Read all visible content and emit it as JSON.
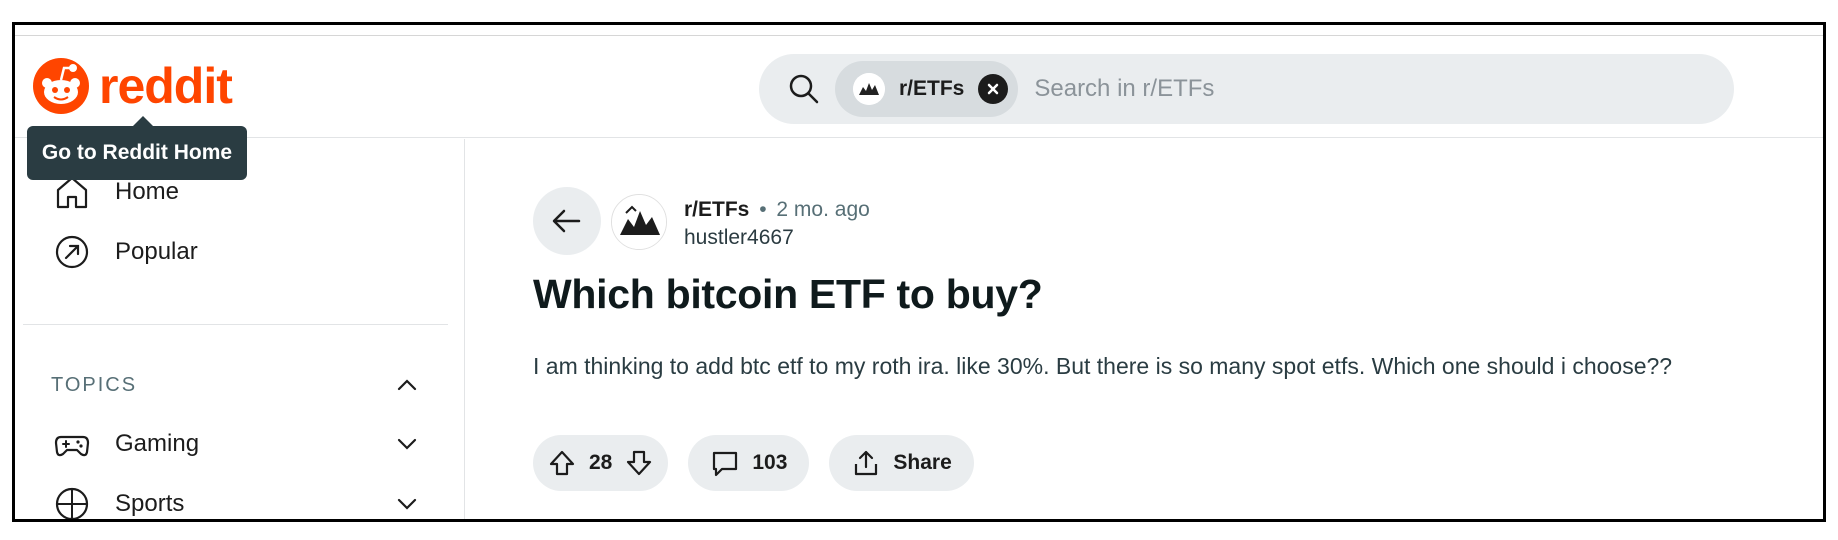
{
  "header": {
    "logo_text": "reddit",
    "brand_color": "#ff4500",
    "tooltip": "Go to Reddit Home",
    "search": {
      "chip_label": "r/ETFs",
      "placeholder": "Search in r/ETFs"
    }
  },
  "sidebar": {
    "items": [
      {
        "label": "Home",
        "icon": "home-icon"
      },
      {
        "label": "Popular",
        "icon": "popular-icon"
      }
    ],
    "topics_label": "TOPICS",
    "topics": [
      {
        "label": "Gaming",
        "icon": "gamepad-icon"
      },
      {
        "label": "Sports",
        "icon": "sports-icon"
      }
    ]
  },
  "post": {
    "subreddit": "r/ETFs",
    "separator": "•",
    "time": "2 mo. ago",
    "author": "hustler4667",
    "title": "Which bitcoin ETF to buy?",
    "body": "I am thinking to add btc etf to my roth ira. like 30%. But there is so many spot etfs. Which one should i choose??",
    "votes": "28",
    "comments": "103",
    "share_label": "Share"
  }
}
